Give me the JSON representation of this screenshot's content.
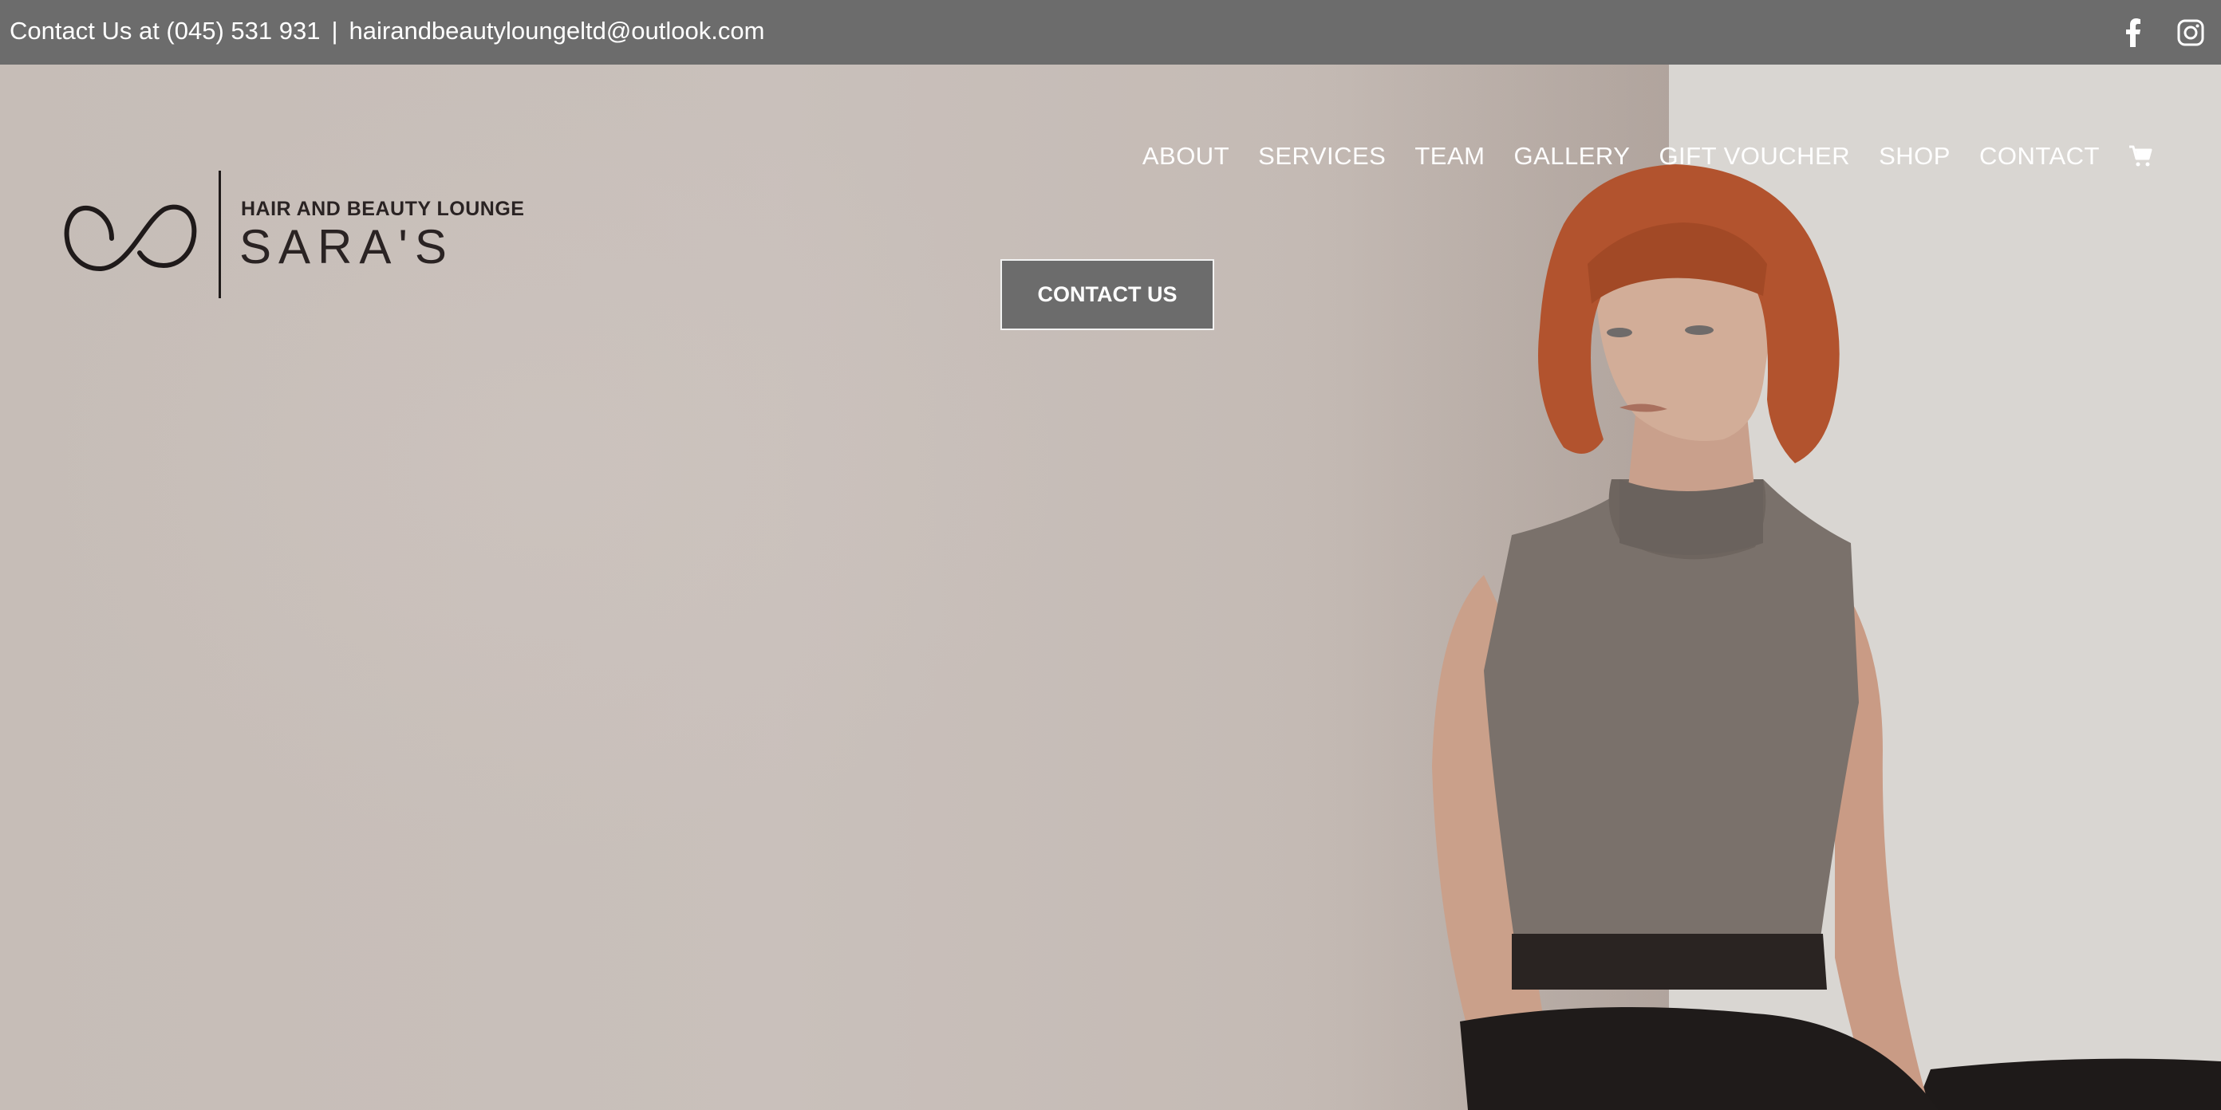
{
  "topbar": {
    "contact_text": "Contact Us at (045) 531 931",
    "separator": "|",
    "email": "hairandbeautyloungeltd@outlook.com",
    "social": [
      "facebook-icon",
      "instagram-icon"
    ]
  },
  "logo": {
    "tagline": "HAIR AND BEAUTY LOUNGE",
    "brand": "SARA'S"
  },
  "nav": {
    "items": [
      {
        "label": "ABOUT"
      },
      {
        "label": "SERVICES"
      },
      {
        "label": "TEAM"
      },
      {
        "label": "GALLERY"
      },
      {
        "label": "GIFT VOUCHER"
      },
      {
        "label": "SHOP"
      },
      {
        "label": "CONTACT"
      }
    ],
    "cart_icon": "cart-icon"
  },
  "hero": {
    "cta_label": "CONTACT US"
  },
  "colors": {
    "topbar_bg": "#6c6c6c",
    "button_bg": "#6c6c6c",
    "logo_text": "#2a2323",
    "nav_text": "#ffffff"
  }
}
